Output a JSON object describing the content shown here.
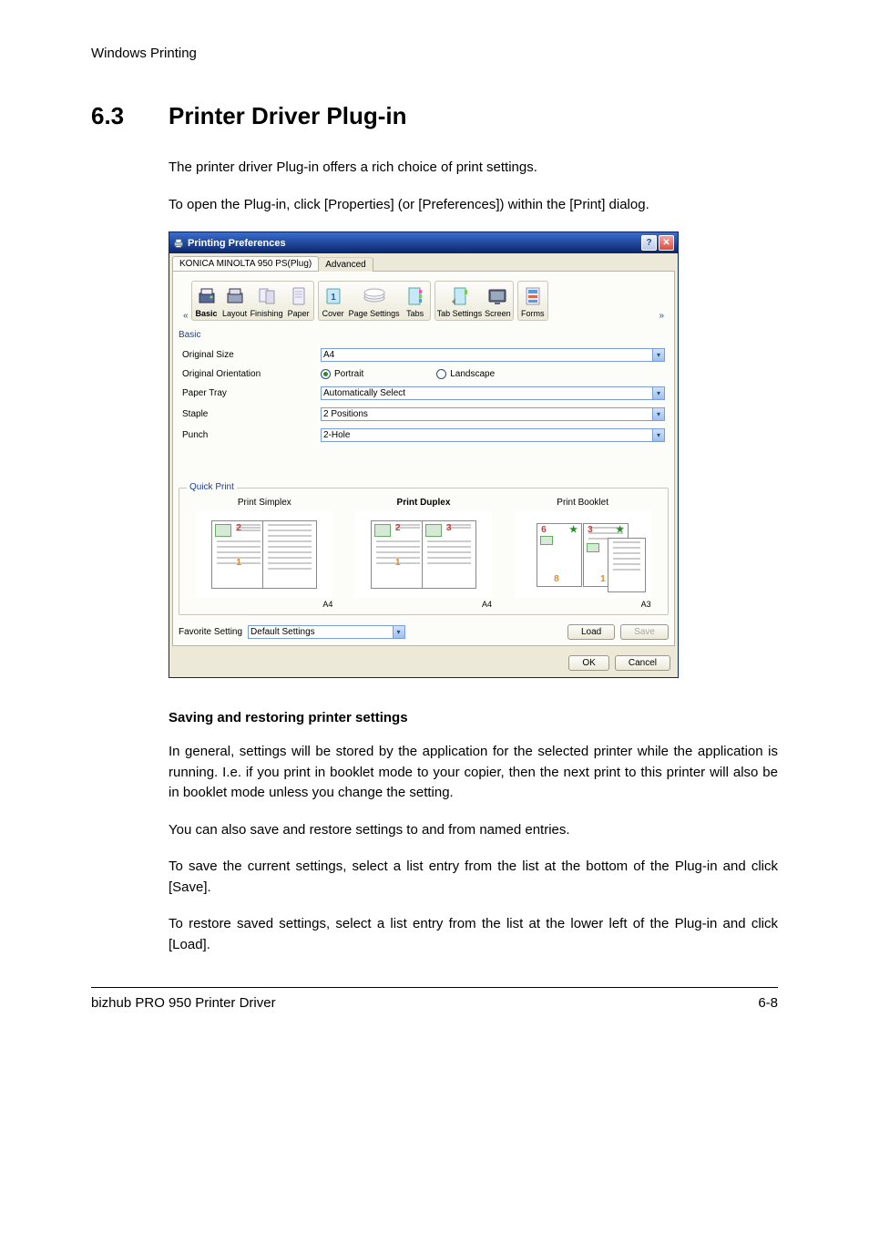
{
  "page": {
    "header": "Windows Printing",
    "section_number": "6.3",
    "section_title": "Printer Driver Plug-in",
    "p1": "The printer driver Plug-in offers a rich choice of print settings.",
    "p2": "To open the Plug-in, click [Properties] (or [Preferences]) within the [Print] dialog.",
    "sub_heading": "Saving and restoring printer settings",
    "p3": "In general, settings will be stored by the application for the selected printer while the application is running. I.e. if you print in booklet mode to your copier, then the next print to this printer will also be in booklet mode unless you change the setting.",
    "p4": "You can also save and restore settings to and from named entries.",
    "p5": "To save the current settings, select a list entry from the list at the bottom of the Plug-in and click [Save].",
    "p6": "To restore saved settings, select a list entry from the list at the lower left of the Plug-in and click [Load].",
    "footer_left": "bizhub PRO 950 Printer Driver",
    "footer_right": "6-8"
  },
  "dialog": {
    "title": "Printing Preferences",
    "tabs": {
      "active": "KONICA MINOLTA 950 PS(Plug)",
      "inactive": "Advanced"
    },
    "toolbar": {
      "basic": "Basic",
      "layout": "Layout",
      "finishing": "Finishing",
      "paper": "Paper",
      "cover": "Cover",
      "page_settings": "Page Settings",
      "tabs": "Tabs",
      "tab_settings": "Tab Settings",
      "screen": "Screen",
      "forms": "Forms"
    },
    "section_label": "Basic",
    "fields": {
      "original_size": {
        "label": "Original Size",
        "value": "A4"
      },
      "original_orientation": {
        "label": "Original Orientation",
        "portrait": "Portrait",
        "landscape": "Landscape"
      },
      "paper_tray": {
        "label": "Paper Tray",
        "value": "Automatically Select"
      },
      "staple": {
        "label": "Staple",
        "value": "2 Positions"
      },
      "punch": {
        "label": "Punch",
        "value": "2-Hole"
      }
    },
    "quick_print": {
      "legend": "Quick Print",
      "simplex": "Print Simplex",
      "duplex": "Print Duplex",
      "booklet": "Print Booklet",
      "size_a4": "A4",
      "size_a3": "A3"
    },
    "favorite": {
      "label": "Favorite Setting",
      "value": "Default Settings",
      "load": "Load",
      "save": "Save"
    },
    "buttons": {
      "ok": "OK",
      "cancel": "Cancel"
    }
  }
}
